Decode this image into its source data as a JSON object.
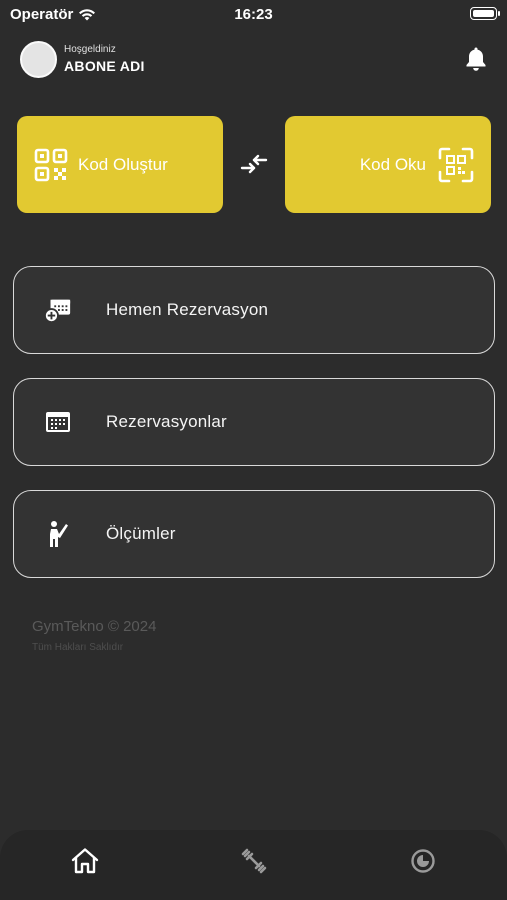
{
  "status_bar": {
    "carrier": "Operatör",
    "time": "16:23"
  },
  "header": {
    "greeting": "Hoşgeldiniz",
    "username": "ABONE ADI"
  },
  "qr_actions": {
    "create_label": "Kod Oluştur",
    "read_label": "Kod Oku"
  },
  "menu": {
    "items": [
      {
        "label": "Hemen Rezervasyon",
        "icon": "calendar-add-icon"
      },
      {
        "label": "Rezervasyonlar",
        "icon": "calendar-icon"
      },
      {
        "label": "Ölçümler",
        "icon": "person-measure-icon"
      }
    ]
  },
  "footer": {
    "brand": "GymTekno © 2024",
    "rights": "Tüm Hakları Saklıdır"
  },
  "tab_bar": {
    "tabs": [
      {
        "icon": "home-icon",
        "active": true
      },
      {
        "icon": "dumbbell-icon",
        "active": false
      },
      {
        "icon": "history-icon",
        "active": false
      }
    ]
  },
  "colors": {
    "background": "#2c2c2c",
    "accent": "#e2c931",
    "tab_bar": "#262626",
    "border": "#d9d9d9"
  }
}
